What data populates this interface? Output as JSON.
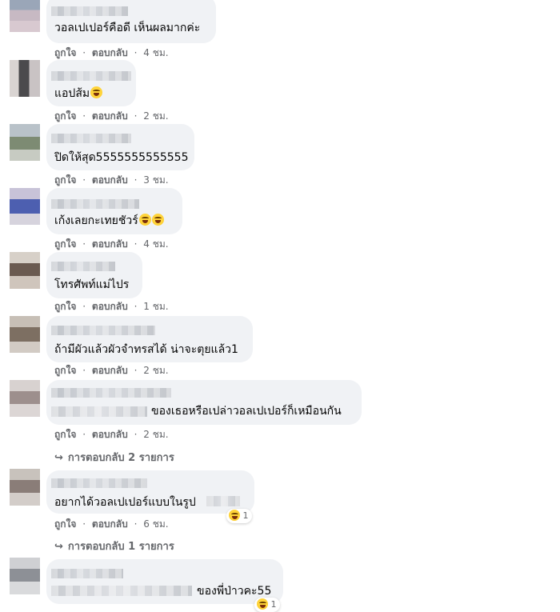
{
  "actions": {
    "like": "ถูกใจ",
    "reply": "ตอบกลับ",
    "separator": "·"
  },
  "comments": [
    {
      "text": "วอลเปเปอร์คือดี เห็นผลมากค่ะ",
      "time": "4 ชม."
    },
    {
      "text": "แอปส้ม",
      "time": "2 ชม.",
      "emojis": [
        "rofl-emoji"
      ]
    },
    {
      "text": "ปิดให้สุด5555555555555",
      "time": "3 ชม."
    },
    {
      "text": "เก้งเลยกะเทยชัวร์",
      "time": "4 ชม.",
      "emojis": [
        "laughing-emoji",
        "rofl-emoji"
      ]
    },
    {
      "text": "โทรศัพท์แม่ไปร",
      "time": "1 ชม."
    },
    {
      "text": "ถ้ามีผัวแล้วผัวจำทรสได้ น่าจะตุยแล้ว1",
      "time": "2 ชม."
    },
    {
      "text": "ของเธอหรือเปล่าวอลเปเปอร์ก็เหมือนกัน",
      "time": "2 ชม.",
      "replies": "การตอบกลับ 2 รายการ"
    },
    {
      "text": "อยากได้วอลเปเปอร์แบบในรูป",
      "time": "6 ชม.",
      "reaction_count": "1",
      "replies": "การตอบกลับ 1 รายการ"
    },
    {
      "text": "ของพี่ป่าวคะ55",
      "reaction_count": "1"
    }
  ],
  "colors": {
    "bubble": "#f0f2f5",
    "meta": "#65676b",
    "text": "#050505"
  }
}
